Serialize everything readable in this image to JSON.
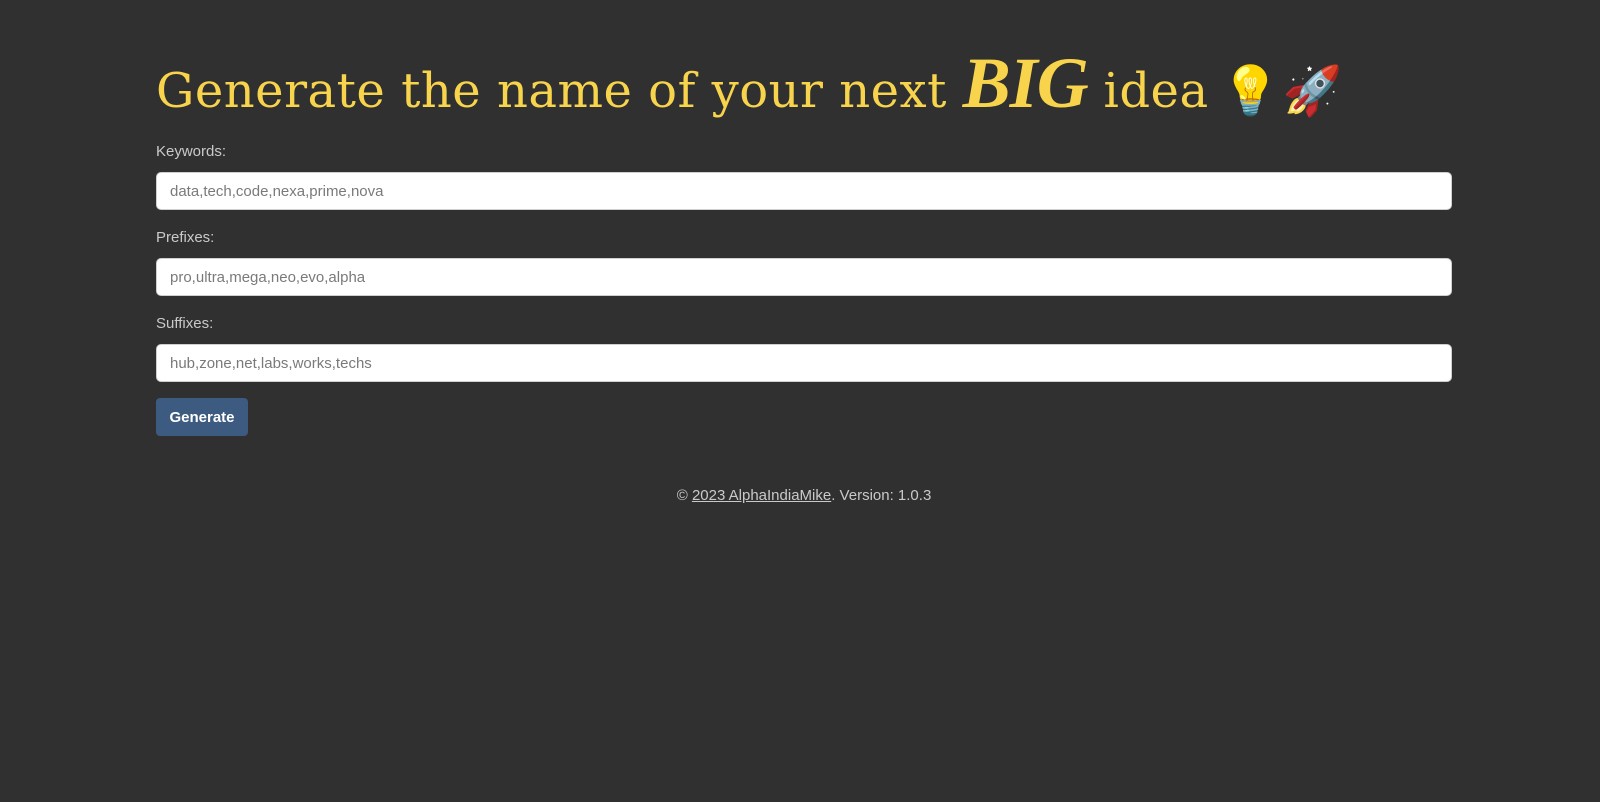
{
  "header": {
    "title_before": "Generate the name of your next ",
    "title_emphasis": "BIG",
    "title_after": " idea",
    "emoji_bulb": "💡",
    "emoji_rocket": "🚀"
  },
  "form": {
    "keywords": {
      "label": "Keywords:",
      "value": "",
      "placeholder": "data,tech,code,nexa,prime,nova"
    },
    "prefixes": {
      "label": "Prefixes:",
      "value": "",
      "placeholder": "pro,ultra,mega,neo,evo,alpha"
    },
    "suffixes": {
      "label": "Suffixes:",
      "value": "",
      "placeholder": "hub,zone,net,labs,works,techs"
    },
    "generate_label": "Generate"
  },
  "footer": {
    "copyright_symbol": "© ",
    "link_text": "2023 AlphaIndiaMike",
    "version_text": ". Version: 1.0.3"
  },
  "colors": {
    "background": "#303030",
    "title": "#f8d44c",
    "button": "#3d5a80",
    "button_text": "#ffffff",
    "label_text": "#c9c9c9"
  }
}
